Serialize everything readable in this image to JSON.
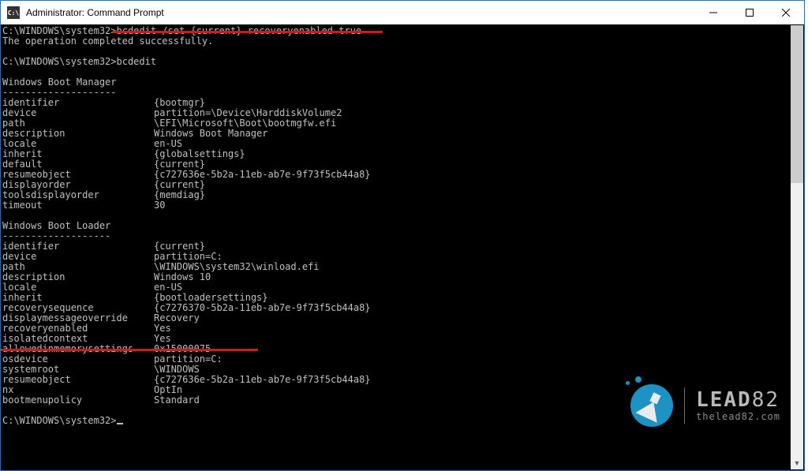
{
  "window": {
    "icon_text": "C:\\",
    "title": "Administrator: Command Prompt"
  },
  "prompt": "C:\\WINDOWS\\system32>",
  "cmd1": "bcdedit /set {current} recoveryenabled true",
  "result1": "The operation completed successfully.",
  "cmd2": "bcdedit",
  "sections": [
    {
      "title": "Windows Boot Manager",
      "rule": "--------------------",
      "rows": [
        {
          "k": "identifier",
          "v": "{bootmgr}"
        },
        {
          "k": "device",
          "v": "partition=\\Device\\HarddiskVolume2"
        },
        {
          "k": "path",
          "v": "\\EFI\\Microsoft\\Boot\\bootmgfw.efi"
        },
        {
          "k": "description",
          "v": "Windows Boot Manager"
        },
        {
          "k": "locale",
          "v": "en-US"
        },
        {
          "k": "inherit",
          "v": "{globalsettings}"
        },
        {
          "k": "default",
          "v": "{current}"
        },
        {
          "k": "resumeobject",
          "v": "{c727636e-5b2a-11eb-ab7e-9f73f5cb44a8}"
        },
        {
          "k": "displayorder",
          "v": "{current}"
        },
        {
          "k": "toolsdisplayorder",
          "v": "{memdiag}"
        },
        {
          "k": "timeout",
          "v": "30"
        }
      ]
    },
    {
      "title": "Windows Boot Loader",
      "rule": "-------------------",
      "rows": [
        {
          "k": "identifier",
          "v": "{current}"
        },
        {
          "k": "device",
          "v": "partition=C:"
        },
        {
          "k": "path",
          "v": "\\WINDOWS\\system32\\winload.efi"
        },
        {
          "k": "description",
          "v": "Windows 10"
        },
        {
          "k": "locale",
          "v": "en-US"
        },
        {
          "k": "inherit",
          "v": "{bootloadersettings}"
        },
        {
          "k": "recoverysequence",
          "v": "{c7276370-5b2a-11eb-ab7e-9f73f5cb44a8}"
        },
        {
          "k": "displaymessageoverride",
          "v": "Recovery"
        },
        {
          "k": "recoveryenabled",
          "v": "Yes"
        },
        {
          "k": "isolatedcontext",
          "v": "Yes"
        },
        {
          "k": "allowedinmemorysettings",
          "v": "0x15000075"
        },
        {
          "k": "osdevice",
          "v": "partition=C:"
        },
        {
          "k": "systemroot",
          "v": "\\WINDOWS"
        },
        {
          "k": "resumeobject",
          "v": "{c727636e-5b2a-11eb-ab7e-9f73f5cb44a8}"
        },
        {
          "k": "nx",
          "v": "OptIn"
        },
        {
          "k": "bootmenupolicy",
          "v": "Standard"
        }
      ]
    }
  ],
  "watermark": {
    "brand_bold": "LEAD",
    "brand_num": "82",
    "url": "thelead82.com"
  }
}
